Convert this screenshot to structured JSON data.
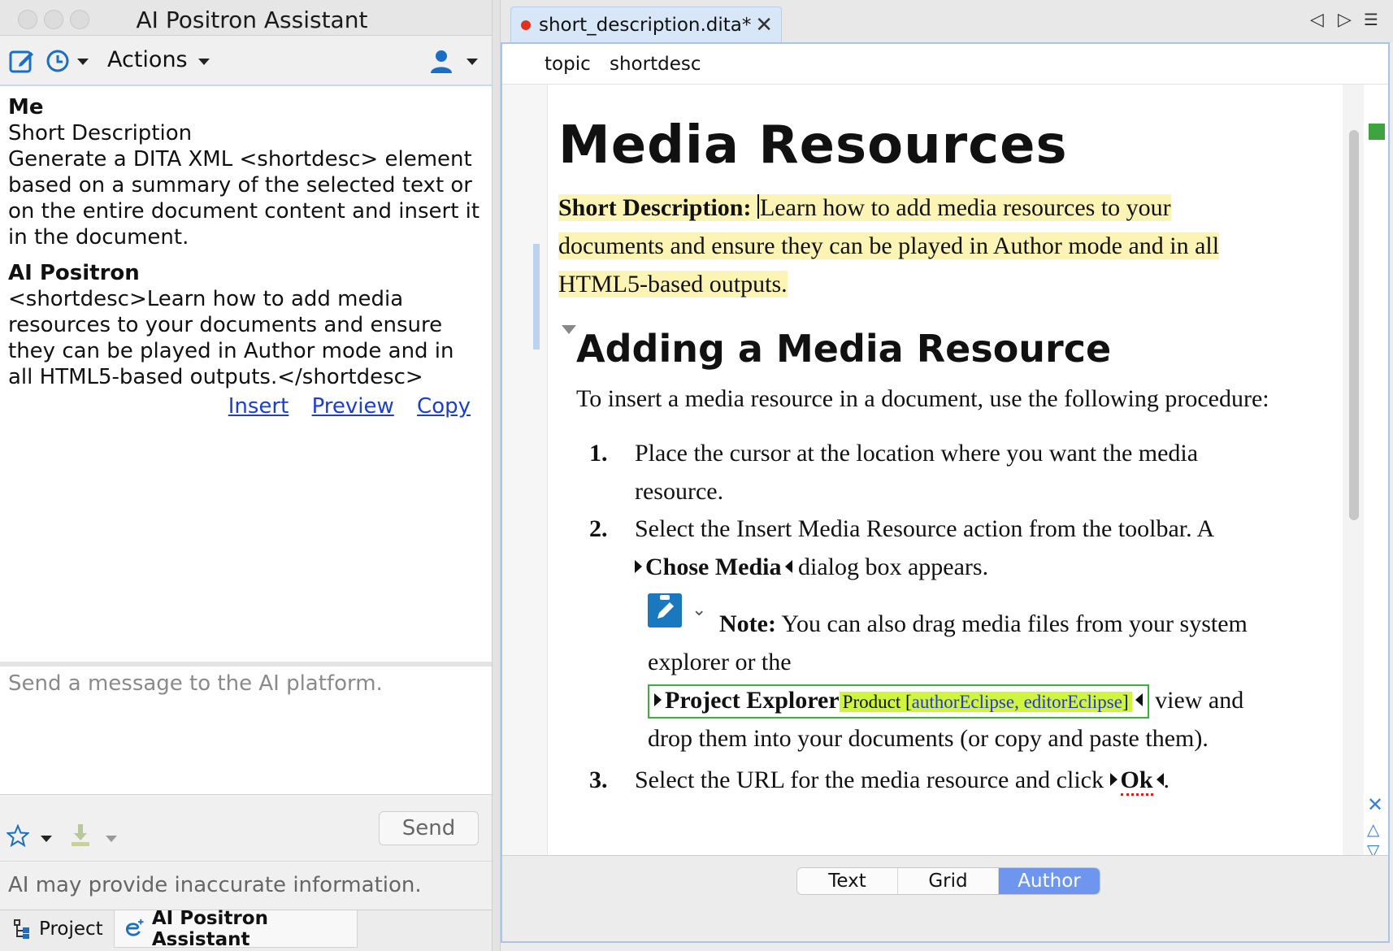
{
  "left_panel": {
    "title": "AI Positron Assistant",
    "toolbar": {
      "new_chat_icon": "edit-icon",
      "history_icon": "history-icon",
      "actions_label": "Actions",
      "user_icon": "user-icon"
    },
    "messages": [
      {
        "sender": "Me",
        "text": "Short Description\nGenerate a DITA XML <shortdesc> element based on a summary of the selected text or on the entire document content and insert it in the document."
      },
      {
        "sender": "AI Positron",
        "text": "<shortdesc>Learn how to add media resources to your documents and ensure they can be played in Author mode and in all HTML5-based outputs.</shortdesc>"
      }
    ],
    "links": {
      "insert": "Insert",
      "preview": "Preview",
      "copy": "Copy"
    },
    "input_placeholder": "Send a message to the AI platform.",
    "send_label": "Send",
    "disclaimer": "AI may provide inaccurate information.",
    "bottom_tabs": {
      "project": "Project",
      "assistant": "AI Positron Assistant"
    }
  },
  "editor": {
    "tab_title": "short_description.dita*",
    "breadcrumb": [
      "topic",
      "shortdesc"
    ],
    "doc_title": "Media Resources",
    "shortdesc_label": "Short Description:",
    "shortdesc_text_1": "Learn how to add media resources to your",
    "shortdesc_text_2": "documents and ensure they can be played in Author mode and in all",
    "shortdesc_text_3": "HTML5-based outputs.",
    "section_title": "Adding a Media Resource",
    "section_intro": "To insert a media resource in a document, use the following procedure:",
    "steps": [
      {
        "num": "1.",
        "line1": "Place the cursor at the location where you want the media",
        "line2": "resource."
      },
      {
        "num": "2.",
        "line1": "Select the Insert Media Resource action from the toolbar. A",
        "ui": "Chose Media",
        "line2_rest": " dialog box appears."
      },
      {
        "num": "3.",
        "pre": "Select the URL for the media resource and click ",
        "ui": "Ok",
        "post": "."
      }
    ],
    "note": {
      "label": "Note:",
      "text1": " You can also drag media files from your system",
      "text2": "explorer or the",
      "ui": "Project Explorer",
      "product_label": "Product [",
      "product_values": "authorEclipse, editorEclipse",
      "product_close": "]",
      "text3": " view and",
      "text4": "drop them into your documents (or copy and paste them)."
    },
    "modes": [
      "Text",
      "Grid",
      "Author"
    ],
    "active_mode": "Author"
  }
}
